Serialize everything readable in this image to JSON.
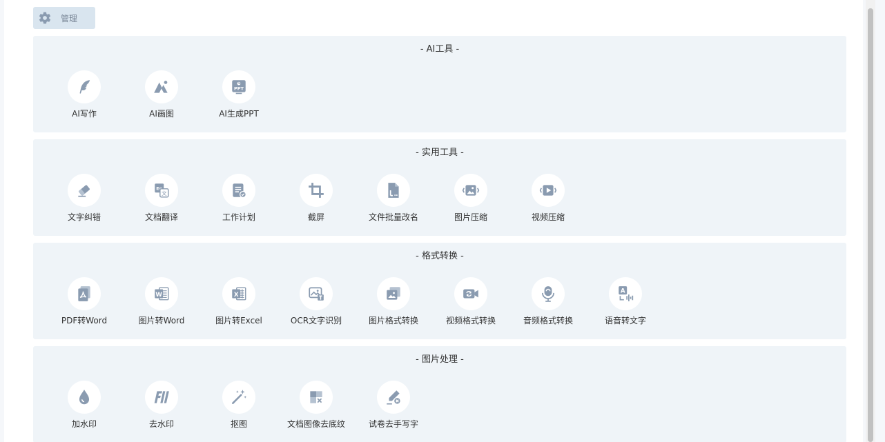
{
  "manage": {
    "label": "管理",
    "icon": "gear-icon"
  },
  "sections": [
    {
      "title": "- AI工具 -",
      "tools": [
        {
          "label": "AI写作",
          "icon": "feather-pen-icon"
        },
        {
          "label": "AI画图",
          "icon": "mountain-sparkle-icon"
        },
        {
          "label": "AI生成PPT",
          "icon": "ppt-icon"
        }
      ]
    },
    {
      "title": "- 实用工具 -",
      "tools": [
        {
          "label": "文字纠错",
          "icon": "eraser-icon"
        },
        {
          "label": "文档翻译",
          "icon": "translate-icon"
        },
        {
          "label": "工作计划",
          "icon": "checklist-icon"
        },
        {
          "label": "截屏",
          "icon": "crop-icon"
        },
        {
          "label": "文件批量改名",
          "icon": "file-rename-icon"
        },
        {
          "label": "图片压缩",
          "icon": "image-compress-icon"
        },
        {
          "label": "视频压缩",
          "icon": "video-compress-icon"
        }
      ]
    },
    {
      "title": "- 格式转换 -",
      "tools": [
        {
          "label": "PDF转Word",
          "icon": "pdf-icon"
        },
        {
          "label": "图片转Word",
          "icon": "word-icon"
        },
        {
          "label": "图片转Excel",
          "icon": "excel-icon"
        },
        {
          "label": "OCR文字识别",
          "icon": "ocr-icon"
        },
        {
          "label": "图片格式转换",
          "icon": "image-convert-icon"
        },
        {
          "label": "视频格式转换",
          "icon": "video-convert-icon"
        },
        {
          "label": "音频格式转换",
          "icon": "microphone-icon"
        },
        {
          "label": "语音转文字",
          "icon": "speech-to-text-icon"
        }
      ]
    },
    {
      "title": "- 图片处理 -",
      "tools": [
        {
          "label": "加水印",
          "icon": "water-drop-icon"
        },
        {
          "label": "去水印",
          "icon": "remove-watermark-icon"
        },
        {
          "label": "抠图",
          "icon": "magic-wand-icon"
        },
        {
          "label": "文档图像去底纹",
          "icon": "remove-background-icon"
        },
        {
          "label": "试卷去手写字",
          "icon": "remove-handwriting-icon"
        }
      ]
    }
  ],
  "colors": {
    "icon": "#8a9bb0",
    "section_bg": "#eff4f8",
    "manage_bg": "#d9e5ef"
  }
}
